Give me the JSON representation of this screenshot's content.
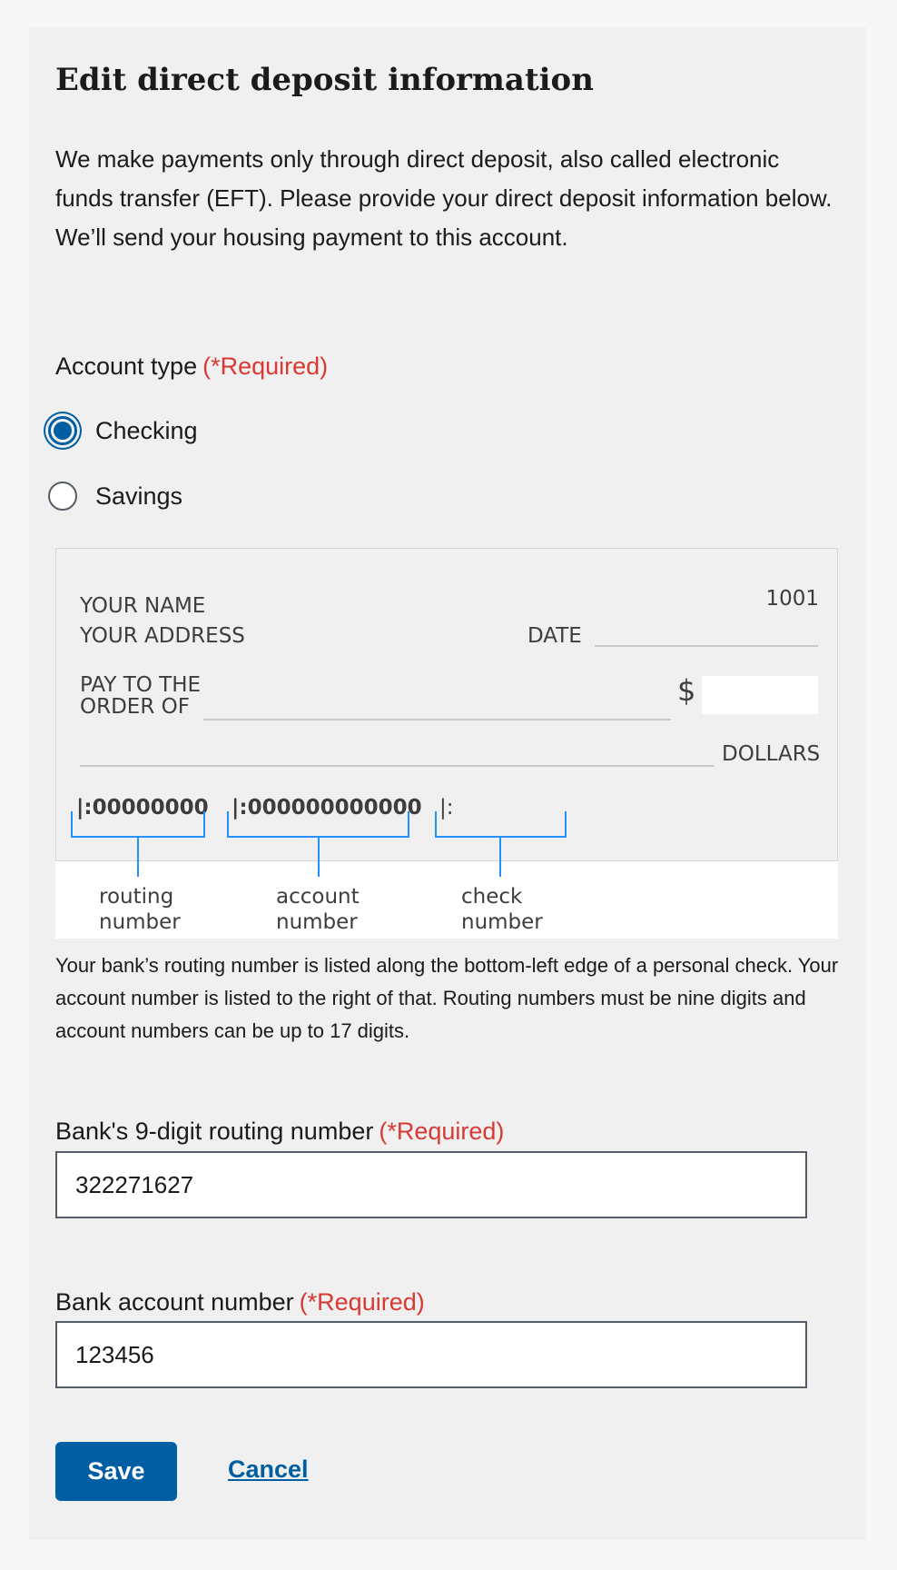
{
  "form": {
    "title": "Edit direct deposit information",
    "intro": "We make payments only through direct deposit, also called electronic funds transfer (EFT). Please provide your direct deposit information below. We’ll send your housing payment to this account.",
    "account_type_label": "Account type",
    "required_text": "(*Required)",
    "options": [
      {
        "label": "Checking",
        "selected": true
      },
      {
        "label": "Savings",
        "selected": false
      }
    ],
    "help_text": "Your bank’s routing number is listed along the bottom-left edge of a personal check. Your account number is listed to the right of that. Routing numbers must be nine digits and account numbers can be up to 17 digits.",
    "routing_label": "Bank's 9-digit routing number",
    "routing_value": "322271627",
    "account_label": "Bank account number",
    "account_value": "123456",
    "save_label": "Save",
    "cancel_label": "Cancel"
  },
  "check": {
    "number": "1001",
    "your_name": "YOUR NAME",
    "your_address": "YOUR ADDRESS",
    "date_label": "DATE",
    "pay_to_line1": "PAY TO THE",
    "pay_to_line2": "ORDER OF",
    "dollar_sign": "$",
    "dollars_label": "DOLLARS",
    "routing_micr": "|:00000000",
    "account_micr": "|:000000000000",
    "check_micr": "|:",
    "routing_caption_1": "routing",
    "routing_caption_2": "number",
    "account_caption_1": "account",
    "account_caption_2": "number",
    "check_caption_1": "check",
    "check_caption_2": "number"
  },
  "colors": {
    "primary": "#005ea2",
    "required": "#d83933",
    "panel_bg": "#f0f0f0"
  }
}
